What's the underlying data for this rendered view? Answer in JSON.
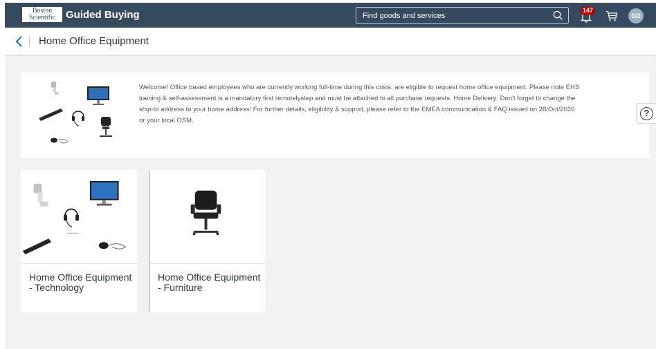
{
  "header": {
    "logo_line1": "Boston",
    "logo_line2": "Scientific",
    "app_title": "Guided Buying",
    "search_placeholder": "Find goods and services",
    "notification_count": "147",
    "avatar_initials": "GD",
    "colors": {
      "shell": "#354a5f",
      "badge": "#bb0000"
    }
  },
  "subheader": {
    "page_title": "Home Office Equipment"
  },
  "banner": {
    "text": "Welcome! Office based employees who are currently working full-time during this crisis, are eligible to request home office equipment.  Please note EHS training & self-assessment is a mandatory first remotelystep and must be attached to all purchase requests. Home Delivery: Don't forget to change the ship-to address to your home address! For further details, eligibility & support, please refer to the EMEA communication & FAQ issued on 28/Oct/2020 or your local OSM."
  },
  "help": {
    "label": "?"
  },
  "tiles": [
    {
      "title": "Home Office Equipment - Technology",
      "icons": [
        "webcam-icon",
        "monitor-icon",
        "headset-icon",
        "keyboard-icon",
        "mouse-icon"
      ]
    },
    {
      "title": "Home Office Equipment - Furniture",
      "icons": [
        "office-chair-icon"
      ]
    }
  ]
}
